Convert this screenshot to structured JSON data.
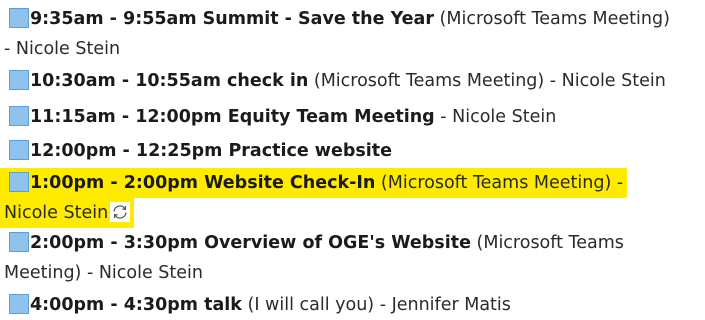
{
  "colors": {
    "highlight": "#ffeb00",
    "calendar_square": "#8fc3ee",
    "calendar_square_border": "#5ba0dc"
  },
  "icons": {
    "calendar": "calendar-square-icon",
    "recurring": "recurring-icon"
  },
  "events": [
    {
      "time_title": "9:35am - 9:55am Summit - Save the Year",
      "line1_rest": " (Microsoft Teams Meeting)",
      "line2": "- Nicole Stein"
    },
    {
      "time_title": "10:30am - 10:55am check in",
      "line1_rest": " (Microsoft Teams Meeting) - Nicole Stein"
    },
    {
      "time_title": "11:15am - 12:00pm Equity Team Meeting",
      "line1_rest": " - Nicole Stein"
    },
    {
      "time_title": "12:00pm - 12:25pm Practice website",
      "line1_rest": ""
    },
    {
      "time_title": "1:00pm - 2:00pm Website Check-In",
      "line1_rest": " (Microsoft Teams Meeting) -",
      "line2": "Nicole Stein",
      "highlighted": true,
      "recurring": true
    },
    {
      "time_title": "2:00pm - 3:30pm Overview of OGE's Website",
      "line1_rest": " (Microsoft Teams",
      "line2": "Meeting) - Nicole Stein"
    },
    {
      "time_title": "4:00pm - 4:30pm talk",
      "line1_rest": " (I will call you) - Jennifer Matis"
    }
  ]
}
